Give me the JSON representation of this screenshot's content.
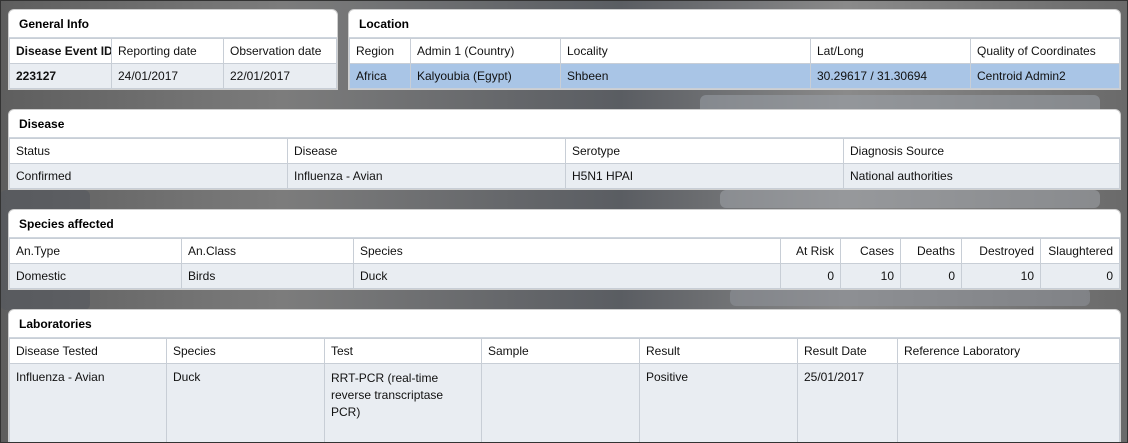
{
  "general": {
    "title": "General Info",
    "headers": [
      "Disease Event ID",
      "Reporting date",
      "Observation date"
    ],
    "row": [
      "223127",
      "24/01/2017",
      "22/01/2017"
    ]
  },
  "location": {
    "title": "Location",
    "headers": [
      "Region",
      "Admin 1 (Country)",
      "Locality",
      "Lat/Long",
      "Quality of Coordinates"
    ],
    "row": [
      "Africa",
      "Kalyoubia (Egypt)",
      "Shbeen",
      "30.29617 / 31.30694",
      "Centroid Admin2"
    ]
  },
  "disease": {
    "title": "Disease",
    "headers": [
      "Status",
      "Disease",
      "Serotype",
      "Diagnosis Source"
    ],
    "row": [
      "Confirmed",
      "Influenza - Avian",
      "H5N1 HPAI",
      "National authorities"
    ]
  },
  "species": {
    "title": "Species affected",
    "headers": [
      "An.Type",
      "An.Class",
      "Species",
      "At Risk",
      "Cases",
      "Deaths",
      "Destroyed",
      "Slaughtered"
    ],
    "row": [
      "Domestic",
      "Birds",
      "Duck",
      "0",
      "10",
      "0",
      "10",
      "0"
    ]
  },
  "laboratories": {
    "title": "Laboratories",
    "headers": [
      "Disease Tested",
      "Species",
      "Test",
      "Sample",
      "Result",
      "Result Date",
      "Reference Laboratory"
    ],
    "row": [
      "Influenza - Avian",
      "Duck",
      "RRT-PCR (real-time reverse transcriptase PCR)",
      "",
      "Positive",
      "25/01/2017",
      ""
    ]
  }
}
